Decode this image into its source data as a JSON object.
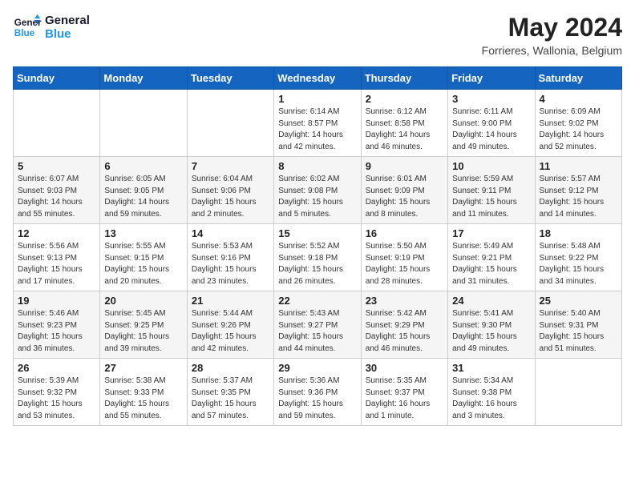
{
  "header": {
    "logo_line1": "General",
    "logo_line2": "Blue",
    "month_year": "May 2024",
    "location": "Forrieres, Wallonia, Belgium"
  },
  "weekdays": [
    "Sunday",
    "Monday",
    "Tuesday",
    "Wednesday",
    "Thursday",
    "Friday",
    "Saturday"
  ],
  "weeks": [
    [
      {
        "day": "",
        "info": ""
      },
      {
        "day": "",
        "info": ""
      },
      {
        "day": "",
        "info": ""
      },
      {
        "day": "1",
        "info": "Sunrise: 6:14 AM\nSunset: 8:57 PM\nDaylight: 14 hours\nand 42 minutes."
      },
      {
        "day": "2",
        "info": "Sunrise: 6:12 AM\nSunset: 8:58 PM\nDaylight: 14 hours\nand 46 minutes."
      },
      {
        "day": "3",
        "info": "Sunrise: 6:11 AM\nSunset: 9:00 PM\nDaylight: 14 hours\nand 49 minutes."
      },
      {
        "day": "4",
        "info": "Sunrise: 6:09 AM\nSunset: 9:02 PM\nDaylight: 14 hours\nand 52 minutes."
      }
    ],
    [
      {
        "day": "5",
        "info": "Sunrise: 6:07 AM\nSunset: 9:03 PM\nDaylight: 14 hours\nand 55 minutes."
      },
      {
        "day": "6",
        "info": "Sunrise: 6:05 AM\nSunset: 9:05 PM\nDaylight: 14 hours\nand 59 minutes."
      },
      {
        "day": "7",
        "info": "Sunrise: 6:04 AM\nSunset: 9:06 PM\nDaylight: 15 hours\nand 2 minutes."
      },
      {
        "day": "8",
        "info": "Sunrise: 6:02 AM\nSunset: 9:08 PM\nDaylight: 15 hours\nand 5 minutes."
      },
      {
        "day": "9",
        "info": "Sunrise: 6:01 AM\nSunset: 9:09 PM\nDaylight: 15 hours\nand 8 minutes."
      },
      {
        "day": "10",
        "info": "Sunrise: 5:59 AM\nSunset: 9:11 PM\nDaylight: 15 hours\nand 11 minutes."
      },
      {
        "day": "11",
        "info": "Sunrise: 5:57 AM\nSunset: 9:12 PM\nDaylight: 15 hours\nand 14 minutes."
      }
    ],
    [
      {
        "day": "12",
        "info": "Sunrise: 5:56 AM\nSunset: 9:13 PM\nDaylight: 15 hours\nand 17 minutes."
      },
      {
        "day": "13",
        "info": "Sunrise: 5:55 AM\nSunset: 9:15 PM\nDaylight: 15 hours\nand 20 minutes."
      },
      {
        "day": "14",
        "info": "Sunrise: 5:53 AM\nSunset: 9:16 PM\nDaylight: 15 hours\nand 23 minutes."
      },
      {
        "day": "15",
        "info": "Sunrise: 5:52 AM\nSunset: 9:18 PM\nDaylight: 15 hours\nand 26 minutes."
      },
      {
        "day": "16",
        "info": "Sunrise: 5:50 AM\nSunset: 9:19 PM\nDaylight: 15 hours\nand 28 minutes."
      },
      {
        "day": "17",
        "info": "Sunrise: 5:49 AM\nSunset: 9:21 PM\nDaylight: 15 hours\nand 31 minutes."
      },
      {
        "day": "18",
        "info": "Sunrise: 5:48 AM\nSunset: 9:22 PM\nDaylight: 15 hours\nand 34 minutes."
      }
    ],
    [
      {
        "day": "19",
        "info": "Sunrise: 5:46 AM\nSunset: 9:23 PM\nDaylight: 15 hours\nand 36 minutes."
      },
      {
        "day": "20",
        "info": "Sunrise: 5:45 AM\nSunset: 9:25 PM\nDaylight: 15 hours\nand 39 minutes."
      },
      {
        "day": "21",
        "info": "Sunrise: 5:44 AM\nSunset: 9:26 PM\nDaylight: 15 hours\nand 42 minutes."
      },
      {
        "day": "22",
        "info": "Sunrise: 5:43 AM\nSunset: 9:27 PM\nDaylight: 15 hours\nand 44 minutes."
      },
      {
        "day": "23",
        "info": "Sunrise: 5:42 AM\nSunset: 9:29 PM\nDaylight: 15 hours\nand 46 minutes."
      },
      {
        "day": "24",
        "info": "Sunrise: 5:41 AM\nSunset: 9:30 PM\nDaylight: 15 hours\nand 49 minutes."
      },
      {
        "day": "25",
        "info": "Sunrise: 5:40 AM\nSunset: 9:31 PM\nDaylight: 15 hours\nand 51 minutes."
      }
    ],
    [
      {
        "day": "26",
        "info": "Sunrise: 5:39 AM\nSunset: 9:32 PM\nDaylight: 15 hours\nand 53 minutes."
      },
      {
        "day": "27",
        "info": "Sunrise: 5:38 AM\nSunset: 9:33 PM\nDaylight: 15 hours\nand 55 minutes."
      },
      {
        "day": "28",
        "info": "Sunrise: 5:37 AM\nSunset: 9:35 PM\nDaylight: 15 hours\nand 57 minutes."
      },
      {
        "day": "29",
        "info": "Sunrise: 5:36 AM\nSunset: 9:36 PM\nDaylight: 15 hours\nand 59 minutes."
      },
      {
        "day": "30",
        "info": "Sunrise: 5:35 AM\nSunset: 9:37 PM\nDaylight: 16 hours\nand 1 minute."
      },
      {
        "day": "31",
        "info": "Sunrise: 5:34 AM\nSunset: 9:38 PM\nDaylight: 16 hours\nand 3 minutes."
      },
      {
        "day": "",
        "info": ""
      }
    ]
  ]
}
